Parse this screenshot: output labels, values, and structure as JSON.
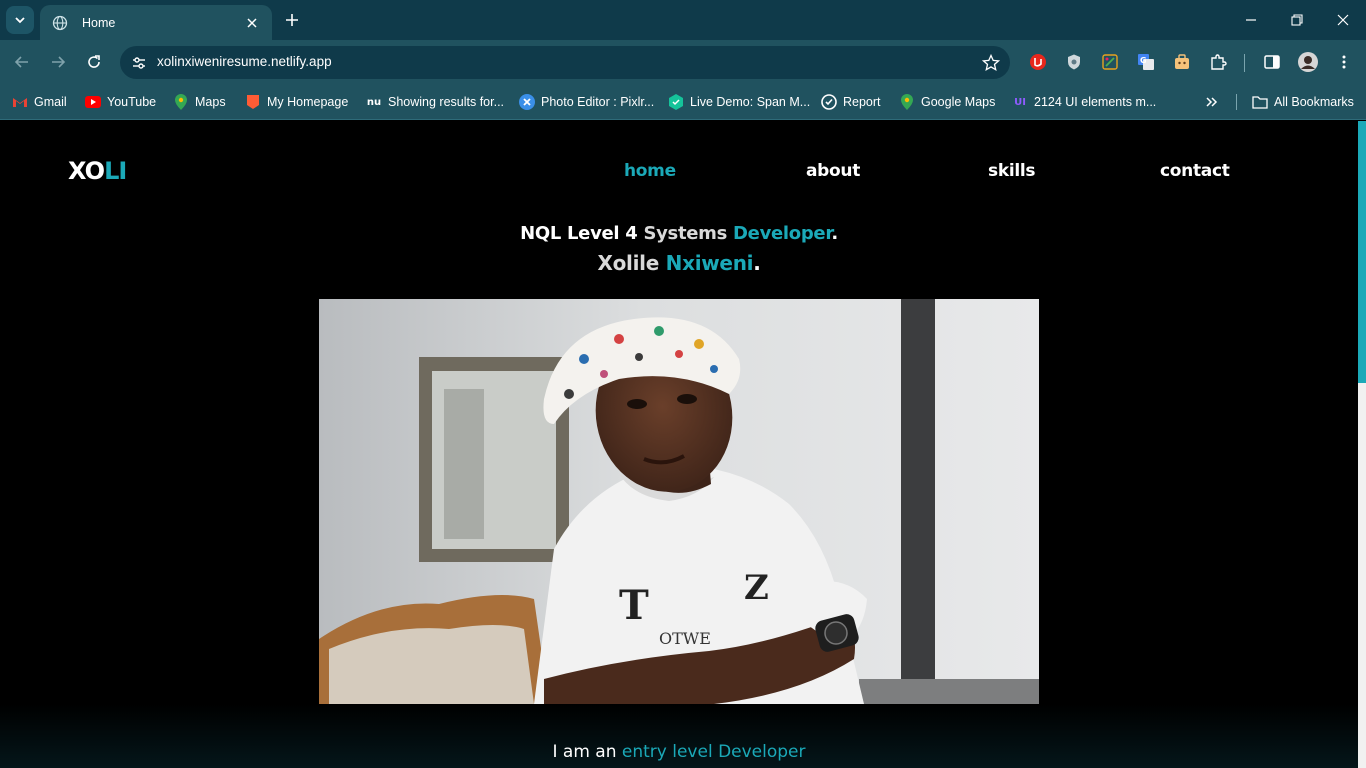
{
  "browser": {
    "tab_title": "Home",
    "url": "xolinxiweniresume.netlify.app",
    "bookmarks": [
      {
        "label": "Gmail",
        "icon": "gmail-icon"
      },
      {
        "label": "YouTube",
        "icon": "youtube-icon"
      },
      {
        "label": "Maps",
        "icon": "maps-icon"
      },
      {
        "label": "My Homepage",
        "icon": "homepage-icon"
      },
      {
        "label": "Showing results for...",
        "icon": "nu-icon"
      },
      {
        "label": "Photo Editor : Pixlr...",
        "icon": "pixlr-icon"
      },
      {
        "label": "Live Demo: Span M...",
        "icon": "demo-icon"
      },
      {
        "label": "Report",
        "icon": "report-icon"
      },
      {
        "label": "Google Maps",
        "icon": "maps-icon"
      },
      {
        "label": "2124 UI elements m...",
        "icon": "ui-icon"
      }
    ],
    "all_bookmarks": "All Bookmarks",
    "ui_badge": "UI"
  },
  "site": {
    "logo_main": "XO",
    "logo_accent": "LI",
    "nav": [
      {
        "label": "home",
        "active": true
      },
      {
        "label": "about",
        "active": false
      },
      {
        "label": "skills",
        "active": false
      },
      {
        "label": "contact",
        "active": false
      }
    ],
    "headline1": {
      "part1": "NQL Level 4",
      "part2": "Systems",
      "part3": "Developer",
      "dot": "."
    },
    "headline2": {
      "first": "Xolile",
      "last": "Nxiweni",
      "dot": "."
    },
    "intro": {
      "prefix": "I am an",
      "highlight": "entry level Developer"
    }
  },
  "colors": {
    "accent": "#1ba9b8",
    "chrome_dark": "#0f3a4a",
    "chrome_light": "#20525f",
    "page_bg": "#000000"
  }
}
